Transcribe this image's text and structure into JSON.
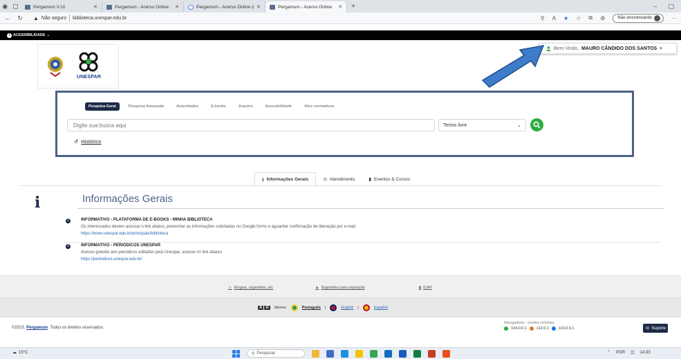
{
  "browser": {
    "tabs": [
      {
        "label": "Pergamum V.10",
        "fav": "p"
      },
      {
        "label": "Pergamum - Acervo Online",
        "fav": "p"
      },
      {
        "label": "Pergamum - Acervo Online (unic",
        "fav": "g"
      },
      {
        "label": "Pergamum - Acervo Online",
        "fav": "p"
      }
    ],
    "not_secure": "Não seguro",
    "url": "biblioteca.unespar.edu.br",
    "sync": "Não sincronizando"
  },
  "site": {
    "accessibility": "ACESSIBILIDADE",
    "logo_text": "UNESPAR",
    "welcome_prefix": "Bem Vindo,",
    "welcome_name": "MAURO CÂNDIDO DOS SANTOS",
    "search_tabs": [
      "Pesquisa Geral",
      "Pesquisa Avançada",
      "Autoridades",
      "E-books",
      "Arquivo",
      "Acessibilidade",
      "Atos normativos"
    ],
    "search_placeholder": "Digite sua busca aqui",
    "search_type": "Termo livre",
    "history": "Histórico",
    "info_tabs": [
      "Informações Gerais",
      "Atendimento",
      "Eventos & Cursos"
    ],
    "info_title": "Informações Gerais",
    "news": [
      {
        "heading": "INFORMATIVO - PLATAFORMA DE E-BOOKS - MINHA BIBLIOTECA",
        "desc": "Os interessados devem acessar o link abaixo, preencher as informações solicitadas no Google forms e aguardar confirmação de liberação por e-mail.",
        "link": "https://www.unespar.edu.br/principais/biblioteca"
      },
      {
        "heading": "INFORMATIVO - PERIÓDICOS UNESPAR",
        "desc": "Acesso gratuito aos periódicos editados pela Unespar, acesse no link abaixo",
        "link": "https://periodicos.unespar.edu.br/"
      }
    ],
    "footer_links": [
      "Elogios, sugestões, etc",
      "Sugestões para aquisição",
      "ICAP"
    ],
    "lang_label": "Idioma:",
    "langs": [
      "Português",
      "English",
      "Español"
    ],
    "copyright_prefix": "©2023.",
    "copyright_brand": "Pergamum",
    "copyright_suffix": ". Todos os direitos reservados.",
    "nav_req_label": "Navegadores - versões mínimas:",
    "nav_versions": [
      "104.0.0.1",
      "110.0.1",
      "110.0.0.1"
    ],
    "support": "Suporte"
  },
  "taskbar": {
    "temp": "15°C",
    "search": "Pesquisar",
    "lang": "POR",
    "time": "14:33"
  },
  "colors": {
    "panel_border": "#4e6187",
    "active_tab": "#1b2a45",
    "search_btn": "#2eaa3f",
    "arrow": "#3d7cc9"
  }
}
